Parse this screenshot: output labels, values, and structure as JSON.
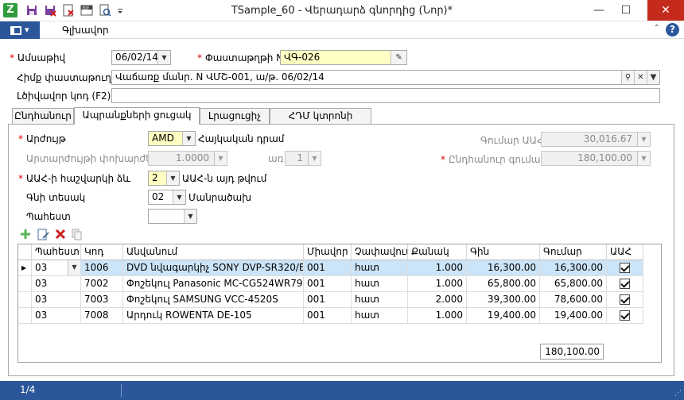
{
  "window": {
    "title": "TSample_60 - Վերադարձ գնորդից (Նոր)*",
    "app_icon_letter": "Z",
    "quick_access": [
      "save-icon",
      "save-close-icon",
      "close-doc-icon",
      "pdf-icon",
      "print-preview-icon",
      "customize-icon"
    ],
    "controls": {
      "minimize": "—",
      "maximize": "☐",
      "close": "✕"
    }
  },
  "ribbon": {
    "main_tab": "Գլխավոր",
    "help": "?"
  },
  "header": {
    "date_label": "Ամսաթիվ",
    "date_value": "06/02/14",
    "docnum_label": "Փաստաթղթի N",
    "docnum_value": "ՎԳ-026",
    "basis_label": "Հիմք փաստաթուղթ",
    "basis_value": "Վաճառք մանր. N ՎՄՇ-001, ա/թ.  06/02/14",
    "extra_code_label": "Լծիվավոր կոդ (F2)",
    "extra_code_value": ""
  },
  "tabs": [
    "Ընդհանուր",
    "Ապրանքների ցուցակ",
    "Լրացուցիչ",
    "ՀԴՄ կտրոնի տպում"
  ],
  "form": {
    "currency_label": "Արժույթ",
    "currency_value": "AMD",
    "currency_name": "Հայկական դրամ",
    "rate_label": "Արտարժույթի փոխարժեք",
    "rate_value": "1.0000",
    "per_label": "առ",
    "per_value": "1",
    "vat_method_label": "ԱԱՀ-ի հաշվարկի ձև",
    "vat_method_value": "2",
    "vat_method_desc": "ԱԱՀ-ն այդ թվում",
    "price_type_label": "Գնի տեսակ",
    "price_type_value": "02",
    "price_type_desc": "Մանրածախ",
    "warehouse_label": "Պահեստ",
    "warehouse_value": "",
    "vat_amount_label": "Գումար ԱԱՀ",
    "vat_amount_value": "30,016.67",
    "total_label": "Ընդհանուր գումար",
    "total_value": "180,100.00"
  },
  "grid": {
    "columns": [
      "Պահեստ",
      "Կոդ",
      "Անվանում",
      "Միավոր",
      "Չափավում",
      "Քանակ",
      "Գին",
      "Գումար",
      "ԱԱՀ"
    ],
    "rows": [
      {
        "warehouse": "03",
        "code": "1006",
        "name": "DVD նվագարկիչ SONY DVP-SR320/B",
        "unit": "001",
        "measure": "հատ",
        "qty": "1.000",
        "price": "16,300.00",
        "amount": "16,300.00",
        "vat": true
      },
      {
        "warehouse": "03",
        "code": "7002",
        "name": "Փոշեկուլ Panasonic MC-CG524WR79",
        "unit": "001",
        "measure": "հատ",
        "qty": "1.000",
        "price": "65,800.00",
        "amount": "65,800.00",
        "vat": true
      },
      {
        "warehouse": "03",
        "code": "7003",
        "name": "Փոշեկուլ SAMSUNG VCC-4520S",
        "unit": "001",
        "measure": "հատ",
        "qty": "2.000",
        "price": "39,300.00",
        "amount": "78,600.00",
        "vat": true
      },
      {
        "warehouse": "03",
        "code": "7008",
        "name": "Արդուկ ROWENTA DE-105",
        "unit": "001",
        "measure": "հատ",
        "qty": "1.000",
        "price": "19,400.00",
        "amount": "19,400.00",
        "vat": true
      }
    ],
    "total_amount": "180,100.00"
  },
  "status": {
    "page": "1/4"
  }
}
